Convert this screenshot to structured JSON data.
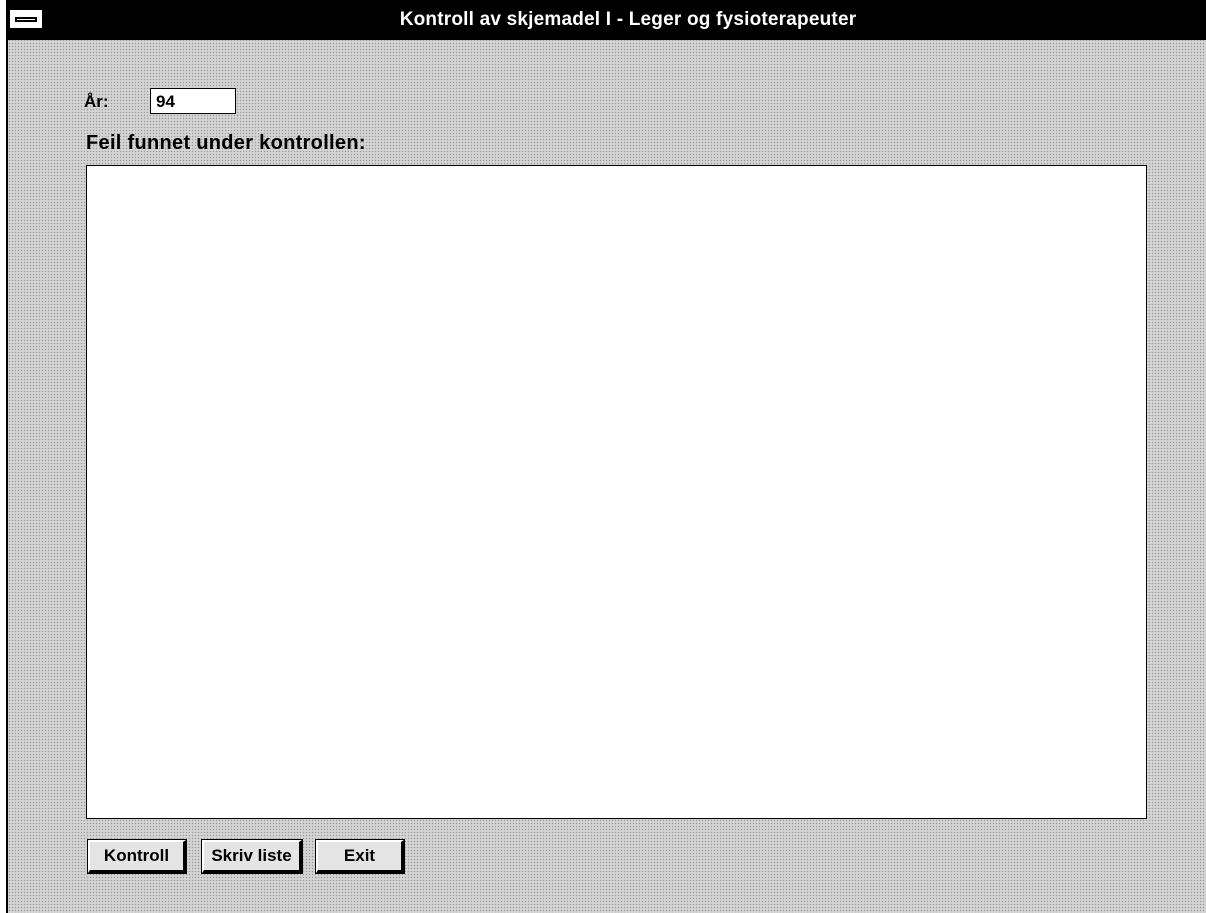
{
  "window": {
    "title": "Kontroll av skjemadel I - Leger og fysioterapeuter"
  },
  "form": {
    "year_label": "År:",
    "year_value": "94",
    "errors_label": "Feil funnet under kontrollen:",
    "errors_items": []
  },
  "buttons": {
    "kontroll": "Kontroll",
    "skriv_liste": "Skriv liste",
    "exit": "Exit"
  }
}
